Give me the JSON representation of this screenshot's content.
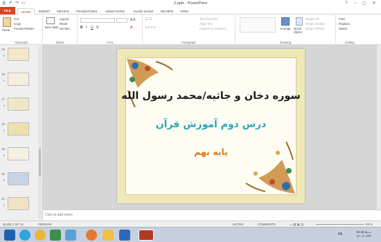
{
  "titlebar": {
    "title": "2.pptx - PowerPoint",
    "quick_access": [
      "save-icon",
      "undo-icon",
      "redo-icon",
      "present-icon"
    ],
    "controls": [
      "?",
      "–",
      "▢",
      "✕"
    ]
  },
  "tabs": [
    "FILE",
    "HOME",
    "INSERT",
    "DESIGN",
    "TRANSITIONS",
    "ANIMATIONS",
    "SLIDE SHOW",
    "REVIEW",
    "VIEW"
  ],
  "active_tab": "HOME",
  "ribbon": {
    "clipboard": {
      "label": "Clipboard",
      "paste": "Paste",
      "cut": "Cut",
      "copy": "Copy",
      "format_painter": "Format Painter"
    },
    "slides": {
      "label": "Slides",
      "new_slide": "New Slide",
      "layout": "Layout",
      "reset": "Reset",
      "section": "Section"
    },
    "font": {
      "label": "Font"
    },
    "paragraph": {
      "label": "Paragraph",
      "text_direction": "Text Direction",
      "align_text": "Align Text",
      "smartart": "Convert to SmartArt"
    },
    "drawing": {
      "label": "Drawing",
      "arrange": "Arrange",
      "quick_styles": "Quick Styles",
      "shape_fill": "Shape Fill",
      "shape_outline": "Shape Outline",
      "shape_effects": "Shape Effects"
    },
    "editing": {
      "label": "Editing",
      "find": "Find",
      "replace": "Replace",
      "select": "Select"
    }
  },
  "thumbnails": [
    {
      "num": "15",
      "color": "#f3e9c9"
    },
    {
      "num": "16",
      "color": "#f5efe0"
    },
    {
      "num": "17",
      "color": "#f1e7c7"
    },
    {
      "num": "18",
      "color": "#eee1b0"
    },
    {
      "num": "19",
      "color": "#f4f1e4"
    },
    {
      "num": "20",
      "color": "#c8d4e6"
    },
    {
      "num": "21",
      "color": "#f1e2c4"
    }
  ],
  "slide": {
    "line1": "سوره دخان و جاثیه/محمد رسول الله",
    "line2": "درس دوم آموزش قرآن",
    "line3": "پایه نهم",
    "colors": {
      "line1": "#1a1a1a",
      "line2": "#2aa7b8",
      "line3": "#d97a1e"
    }
  },
  "notes": {
    "placeholder": "Click to add notes"
  },
  "status": {
    "slide_counter": "SLIDE 2 OF 26",
    "language": "PERSIAN",
    "notes": "NOTES",
    "comments": "COMMENTS",
    "zoom": "69 %"
  },
  "taskbar": {
    "icons": [
      "start-icon",
      "telegram-icon",
      "chrome-icon",
      "media-icon",
      "firefox-icon",
      "folder-icon",
      "explorer-icon",
      "powerpoint-icon"
    ],
    "lang": "FA",
    "time": "01:46 ب.ظ",
    "date": "۱۴۰۱/۰۱/۲۲"
  }
}
